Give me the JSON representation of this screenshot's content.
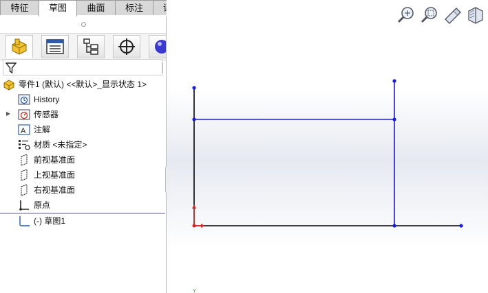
{
  "command_tabs": [
    "特征",
    "草图",
    "曲面",
    "标注",
    "评估"
  ],
  "active_tab": "草图",
  "tree": {
    "root": "零件1 (默认) <<默认>_显示状态 1>",
    "items": [
      {
        "label": "History",
        "icon": "history-icon"
      },
      {
        "label": "传感器",
        "icon": "sensor-icon"
      },
      {
        "label": "注解",
        "icon": "annotation-icon",
        "expandable": true
      },
      {
        "label": "材质 <未指定>",
        "icon": "material-icon"
      },
      {
        "label": "前视基准面",
        "icon": "plane-icon"
      },
      {
        "label": "上视基准面",
        "icon": "plane-icon"
      },
      {
        "label": "右视基准面",
        "icon": "plane-icon"
      },
      {
        "label": "原点",
        "icon": "origin-icon"
      }
    ],
    "sketch": "(-) 草图1"
  },
  "viewport": {
    "axis_label": "Y",
    "colors": {
      "sketch_line": "#1a1ae6",
      "axis": "#000000",
      "origin": "#e02020"
    }
  },
  "view_tools": [
    "zoom-to-fit-icon",
    "zoom-to-area-icon",
    "previous-view-icon",
    "section-view-icon"
  ]
}
